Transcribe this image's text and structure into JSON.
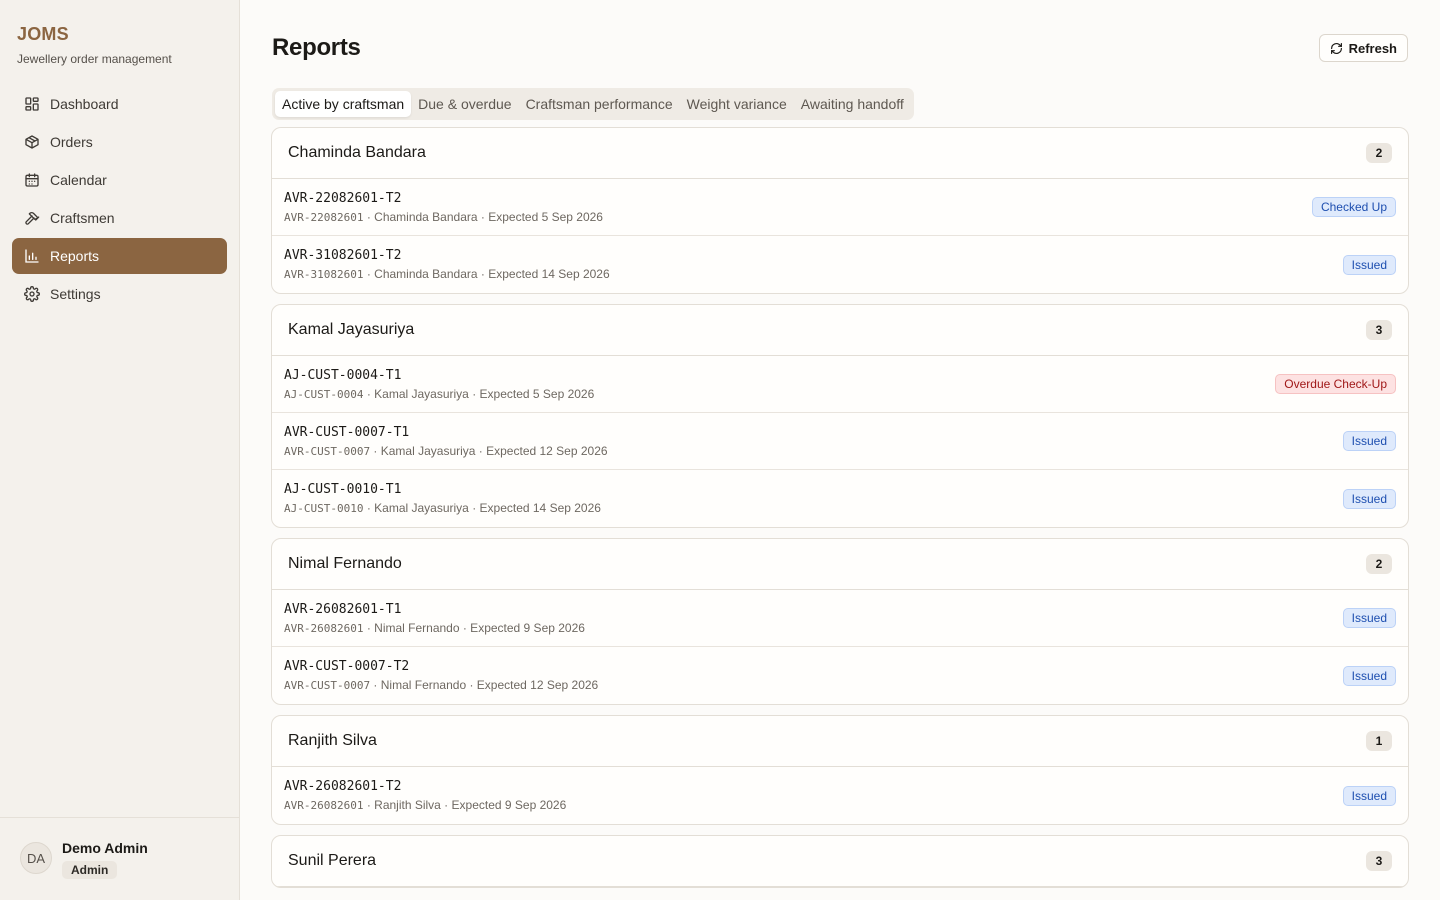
{
  "app": {
    "name": "JOMS",
    "subtitle": "Jewellery order management"
  },
  "nav": [
    {
      "label": "Dashboard",
      "icon": "dashboard-icon",
      "active": false
    },
    {
      "label": "Orders",
      "icon": "box-icon",
      "active": false
    },
    {
      "label": "Calendar",
      "icon": "calendar-icon",
      "active": false
    },
    {
      "label": "Craftsmen",
      "icon": "hammer-icon",
      "active": false
    },
    {
      "label": "Reports",
      "icon": "bar-chart-icon",
      "active": true
    },
    {
      "label": "Settings",
      "icon": "gear-icon",
      "active": false
    }
  ],
  "user": {
    "initials": "DA",
    "name": "Demo Admin",
    "role": "Admin"
  },
  "page": {
    "title": "Reports",
    "refresh_label": "Refresh"
  },
  "tabs": [
    {
      "label": "Active by craftsman",
      "active": true
    },
    {
      "label": "Due & overdue",
      "active": false
    },
    {
      "label": "Craftsman performance",
      "active": false
    },
    {
      "label": "Weight variance",
      "active": false
    },
    {
      "label": "Awaiting handoff",
      "active": false
    }
  ],
  "colors": {
    "accent": "#8b6541",
    "issued_bg": "#dfeafc",
    "issued_text": "#1e4fb0",
    "overdue_bg": "#fde2e2",
    "overdue_text": "#a01818"
  },
  "groups": [
    {
      "name": "Chaminda Bandara",
      "count": "2",
      "rows": [
        {
          "id": "AVR-22082601-T2",
          "order": "AVR-22082601",
          "detail": " · Chaminda Bandara · Expected 5 Sep 2026",
          "status": "Checked Up",
          "status_kind": "issued"
        },
        {
          "id": "AVR-31082601-T2",
          "order": "AVR-31082601",
          "detail": " · Chaminda Bandara · Expected 14 Sep 2026",
          "status": "Issued",
          "status_kind": "issued"
        }
      ]
    },
    {
      "name": "Kamal Jayasuriya",
      "count": "3",
      "rows": [
        {
          "id": "AJ-CUST-0004-T1",
          "order": "AJ-CUST-0004",
          "detail": " · Kamal Jayasuriya · Expected 5 Sep 2026",
          "status": "Overdue Check-Up",
          "status_kind": "overdue"
        },
        {
          "id": "AVR-CUST-0007-T1",
          "order": "AVR-CUST-0007",
          "detail": " · Kamal Jayasuriya · Expected 12 Sep 2026",
          "status": "Issued",
          "status_kind": "issued"
        },
        {
          "id": "AJ-CUST-0010-T1",
          "order": "AJ-CUST-0010",
          "detail": " · Kamal Jayasuriya · Expected 14 Sep 2026",
          "status": "Issued",
          "status_kind": "issued"
        }
      ]
    },
    {
      "name": "Nimal Fernando",
      "count": "2",
      "rows": [
        {
          "id": "AVR-26082601-T1",
          "order": "AVR-26082601",
          "detail": " · Nimal Fernando · Expected 9 Sep 2026",
          "status": "Issued",
          "status_kind": "issued"
        },
        {
          "id": "AVR-CUST-0007-T2",
          "order": "AVR-CUST-0007",
          "detail": " · Nimal Fernando · Expected 12 Sep 2026",
          "status": "Issued",
          "status_kind": "issued"
        }
      ]
    },
    {
      "name": "Ranjith Silva",
      "count": "1",
      "rows": [
        {
          "id": "AVR-26082601-T2",
          "order": "AVR-26082601",
          "detail": " · Ranjith Silva · Expected 9 Sep 2026",
          "status": "Issued",
          "status_kind": "issued"
        }
      ]
    },
    {
      "name": "Sunil Perera",
      "count": "3",
      "rows": []
    }
  ]
}
